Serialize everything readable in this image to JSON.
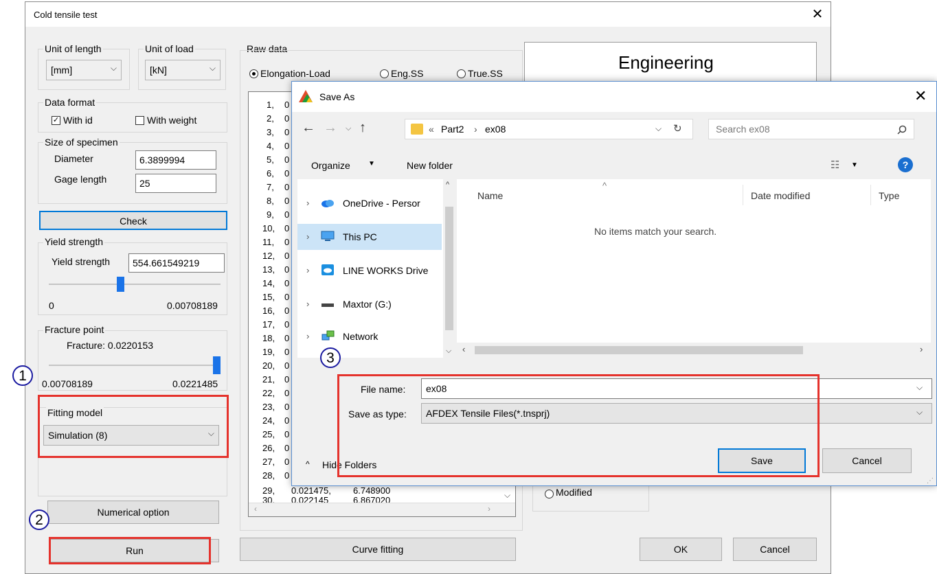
{
  "main": {
    "title": "Cold tensile test",
    "unit_of_length": {
      "label": "Unit of length",
      "value": "[mm]"
    },
    "unit_of_load": {
      "label": "Unit of load",
      "value": "[kN]"
    },
    "data_format": {
      "label": "Data format",
      "with_id": "With id",
      "with_weight": "With weight"
    },
    "specimen": {
      "label": "Size of specimen",
      "diameter_label": "Diameter",
      "diameter_value": "6.3899994",
      "gage_label": "Gage length",
      "gage_value": "25"
    },
    "check_button": "Check",
    "yield": {
      "group": "Yield strength",
      "label": "Yield strength",
      "value": "554.661549219",
      "min": "0",
      "max": "0.00708189",
      "level": 0.42
    },
    "fracture": {
      "group": "Fracture point",
      "text": "Fracture: 0.0220153",
      "min": "0.00708189",
      "max": "0.0221485",
      "level": 0.98
    },
    "fitting": {
      "group": "Fitting model",
      "value": "Simulation (8)"
    },
    "numerical_option": "Numerical option",
    "run": "Run",
    "raw_data": {
      "label": "Raw data",
      "options": [
        "Elongation-Load",
        "Eng.SS",
        "True.SS"
      ],
      "selected": 0,
      "rows": [
        "1,",
        "2,",
        "3,",
        "4,",
        "5,",
        "6,",
        "7,",
        "8,",
        "9,",
        "10,",
        "11,",
        "12,",
        "13,",
        "14,",
        "15,",
        "16,",
        "17,",
        "18,",
        "19,",
        "20,",
        "21,",
        "22,",
        "23,",
        "24,",
        "25,",
        "26,",
        "27,",
        "28,"
      ],
      "row_first_col": "0",
      "row_29": [
        "29,",
        "0.021475,",
        "6.748900"
      ],
      "row_30": [
        "30,",
        "0.022145",
        "6.867020"
      ]
    },
    "curve_fitting": "Curve fitting",
    "right_title": "Engineering",
    "modified_label": "Modified",
    "ok": "OK",
    "cancel": "Cancel"
  },
  "save_dialog": {
    "title": "Save As",
    "breadcrumb": [
      "«",
      "Part2",
      "›",
      "ex08"
    ],
    "search_placeholder": "Search ex08",
    "organize": "Organize",
    "new_folder": "New folder",
    "nav": [
      "OneDrive - Persor",
      "This PC",
      "LINE WORKS Drive",
      "Maxtor (G:)",
      "Network"
    ],
    "nav_selected": 1,
    "columns": [
      "Name",
      "Date modified",
      "Type"
    ],
    "empty_message": "No items match your search.",
    "file_name_label": "File name:",
    "file_name_value": "ex08",
    "save_type_label": "Save as type:",
    "save_type_value": "AFDEX Tensile Files(*.tnsprj)",
    "hide_folders": "Hide Folders",
    "save": "Save",
    "cancel": "Cancel"
  },
  "callouts": [
    "1",
    "2",
    "3"
  ],
  "colors": {
    "accent": "#1a73e8",
    "highlight": "#e5322c",
    "selection": "#cce4f7",
    "callout": "#1a1aa0"
  }
}
